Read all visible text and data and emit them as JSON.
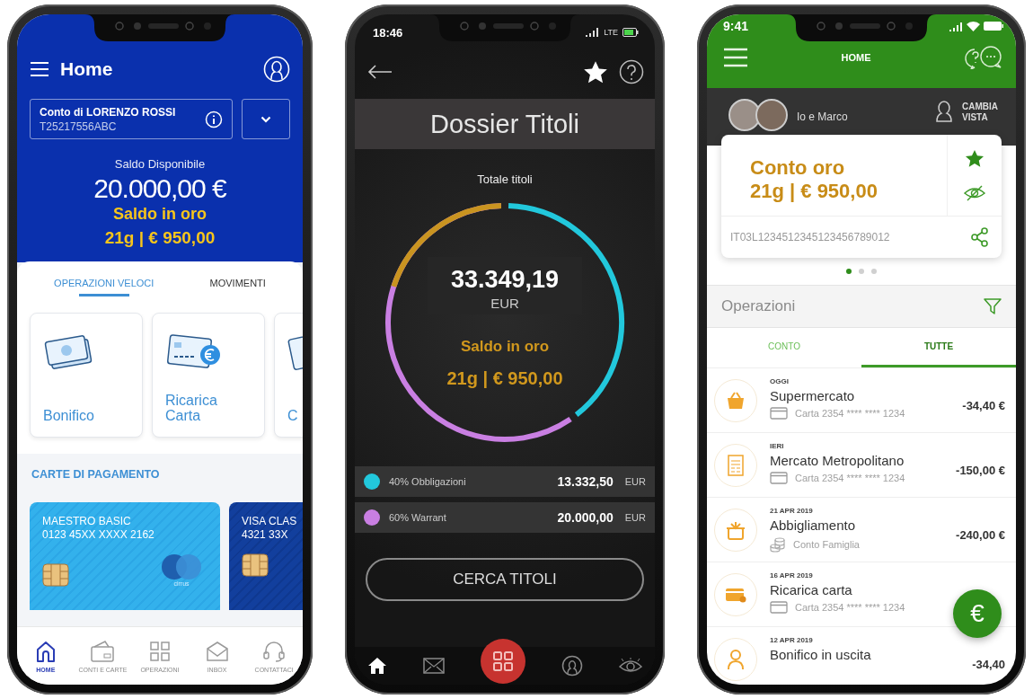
{
  "home_screen": {
    "title": "Home",
    "account": {
      "name": "Conto di LORENZO ROSSI",
      "number": "T25217556ABC"
    },
    "balance_label": "Saldo Disponibile",
    "balance": "20.000,00 €",
    "gold_label": "Saldo in oro",
    "gold_value": "21g | € 950,00",
    "tabs": [
      {
        "label": "OPERAZIONI VELOCI",
        "selected": true
      },
      {
        "label": "MOVIMENTI",
        "selected": false
      }
    ],
    "quick_actions": [
      {
        "label": "Bonifico"
      },
      {
        "label": "Ricarica Carta"
      },
      {
        "label": "C"
      }
    ],
    "cards_title": "CARTE DI PAGAMENTO",
    "cards": [
      {
        "kind": "maestro",
        "name": "MAESTRO BASIC",
        "number": "0123 45XX XXXX 2162",
        "logo_text": "cirrus"
      },
      {
        "kind": "visa",
        "name": "VISA CLAS",
        "number": "4321 33X"
      }
    ],
    "nav": [
      {
        "label": "HOME",
        "selected": true
      },
      {
        "label": "CONTI E CARTE",
        "selected": false
      },
      {
        "label": "OPERAZIONI",
        "selected": false
      },
      {
        "label": "INBOX",
        "selected": false
      },
      {
        "label": "CONTATTACI",
        "selected": false
      }
    ]
  },
  "dossier_screen": {
    "time": "18:46",
    "network": "LTE",
    "title": "Dossier Titoli",
    "total_label": "Totale titoli",
    "total": "33.349,19",
    "currency": "EUR",
    "gold_label": "Saldo in oro",
    "gold_value": "21g | € 950,00",
    "holdings": [
      {
        "label": "40% Obbligazioni",
        "amount": "13.332,50",
        "currency": "EUR",
        "color": "#22c8dc"
      },
      {
        "label": "60% Warrant",
        "amount": "20.000,00",
        "currency": "EUR",
        "color": "#c97fe2"
      }
    ],
    "button": "CERCA TITOLI"
  },
  "family_screen": {
    "time": "9:41",
    "title": "HOME",
    "profile": "Io e Marco",
    "switch_view": "CAMBIA VISTA",
    "account": {
      "title": "Conto oro",
      "value": "21g | € 950,00",
      "iban": "IT03L1234512345123456789012"
    },
    "pager": [
      {
        "selected": true
      },
      {
        "selected": false
      },
      {
        "selected": false
      }
    ],
    "section": "Operazioni",
    "tabs": [
      {
        "label": "CONTO",
        "selected": false
      },
      {
        "label": "TUTTE",
        "selected": true
      }
    ],
    "transactions": [
      {
        "date": "OGGI",
        "name": "Supermercato",
        "kind": "card",
        "source": "Carta 2354 **** **** 1234",
        "amount": "-34,40 €"
      },
      {
        "date": "IERI",
        "name": "Mercato Metropolitano",
        "kind": "card",
        "source": "Carta 2354 **** **** 1234",
        "amount": "-150,00 €"
      },
      {
        "date": "21 APR 2019",
        "name": "Abbigliamento",
        "kind": "account",
        "source": "Conto Famiglia",
        "amount": "-240,00 €"
      },
      {
        "date": "16 APR 2019",
        "name": "Ricarica carta",
        "kind": "card",
        "source": "Carta 2354 **** **** 1234"
      },
      {
        "date": "12 APR 2019",
        "name": "Bonifico in uscita",
        "amount": "-34,40"
      }
    ],
    "fab_label": "€"
  }
}
